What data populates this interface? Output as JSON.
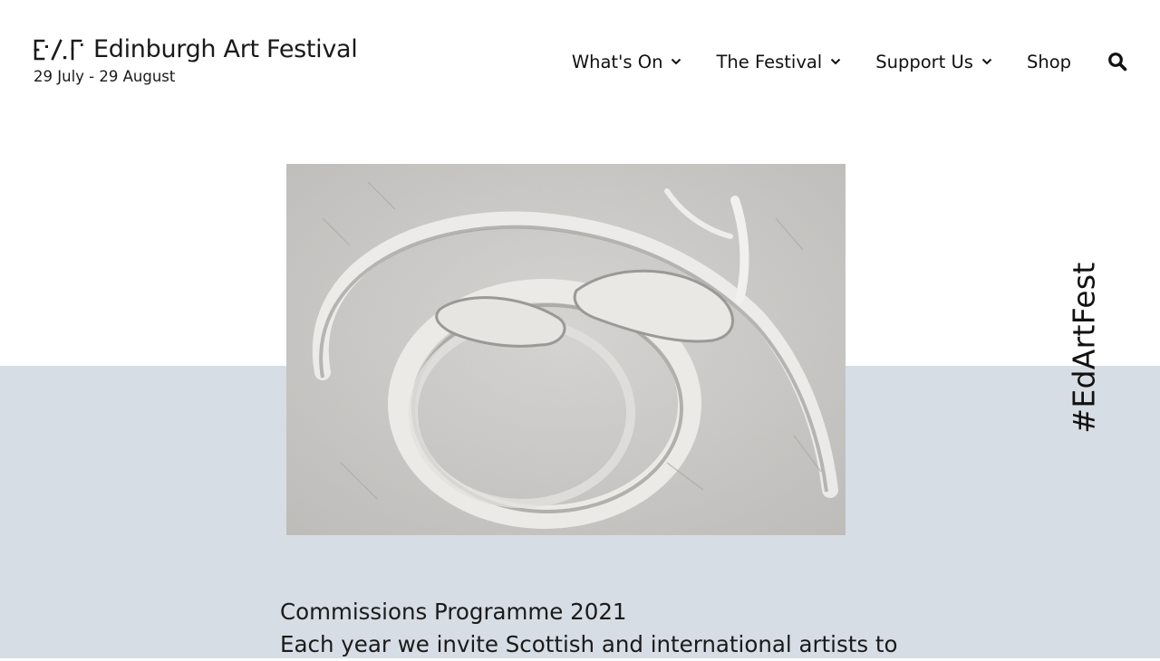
{
  "header": {
    "logo_mark": "E/.F",
    "logo_text": "Edinburgh Art Festival",
    "dates": "29 July - 29 August"
  },
  "nav": {
    "items": [
      {
        "label": "What's On",
        "has_dropdown": true
      },
      {
        "label": "The Festival",
        "has_dropdown": true
      },
      {
        "label": "Support Us",
        "has_dropdown": true
      },
      {
        "label": "Shop",
        "has_dropdown": false
      }
    ],
    "search_icon": "search-icon"
  },
  "hero": {
    "icon": "sculpture-relief-image"
  },
  "hashtag": "#EdArtFest",
  "content": {
    "heading": "Commissions Programme 2021",
    "intro": "Each year we invite Scottish and international artists to"
  },
  "colors": {
    "band": "#d6dde4",
    "text": "#1a1a1a",
    "background": "#ffffff"
  }
}
